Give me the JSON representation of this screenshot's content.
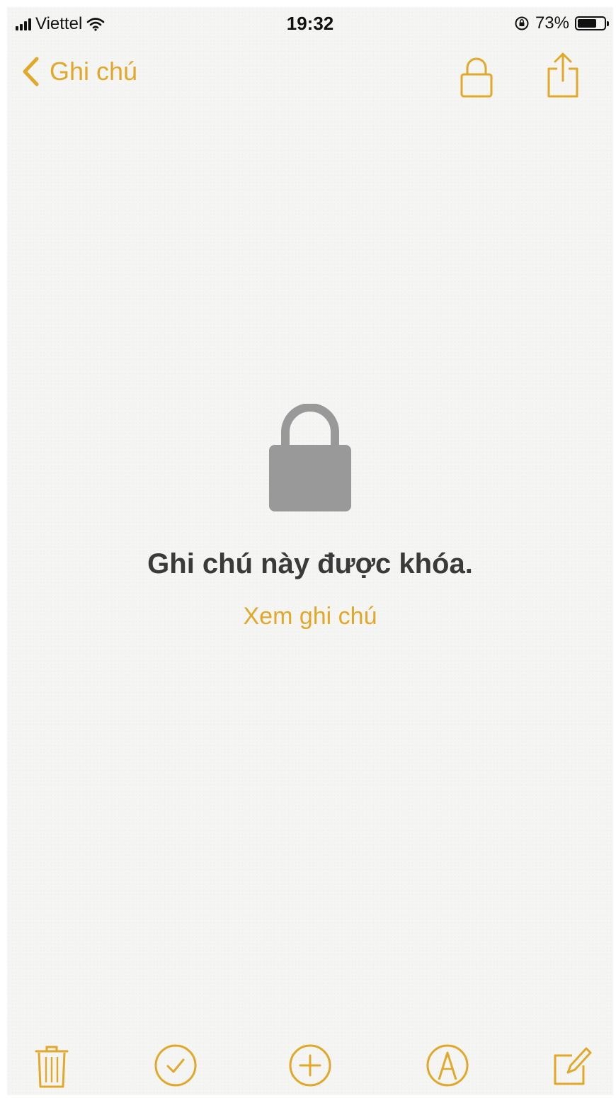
{
  "status_bar": {
    "carrier": "Viettel",
    "time": "19:32",
    "battery_percent": "73%",
    "battery_level": 0.73
  },
  "nav": {
    "back_label": "Ghi chú",
    "icons": [
      "lock-icon",
      "share-icon"
    ]
  },
  "locked": {
    "title": "Ghi chú này được khóa.",
    "view_link": "Xem ghi chú"
  },
  "toolbar": {
    "icons": [
      "trash-icon",
      "checklist-icon",
      "add-icon",
      "markup-icon",
      "compose-icon"
    ]
  },
  "colors": {
    "accent": "#e2a82a",
    "lock_gray": "#999999",
    "title_text": "#3a3a3a",
    "background": "#f5f5f4"
  }
}
